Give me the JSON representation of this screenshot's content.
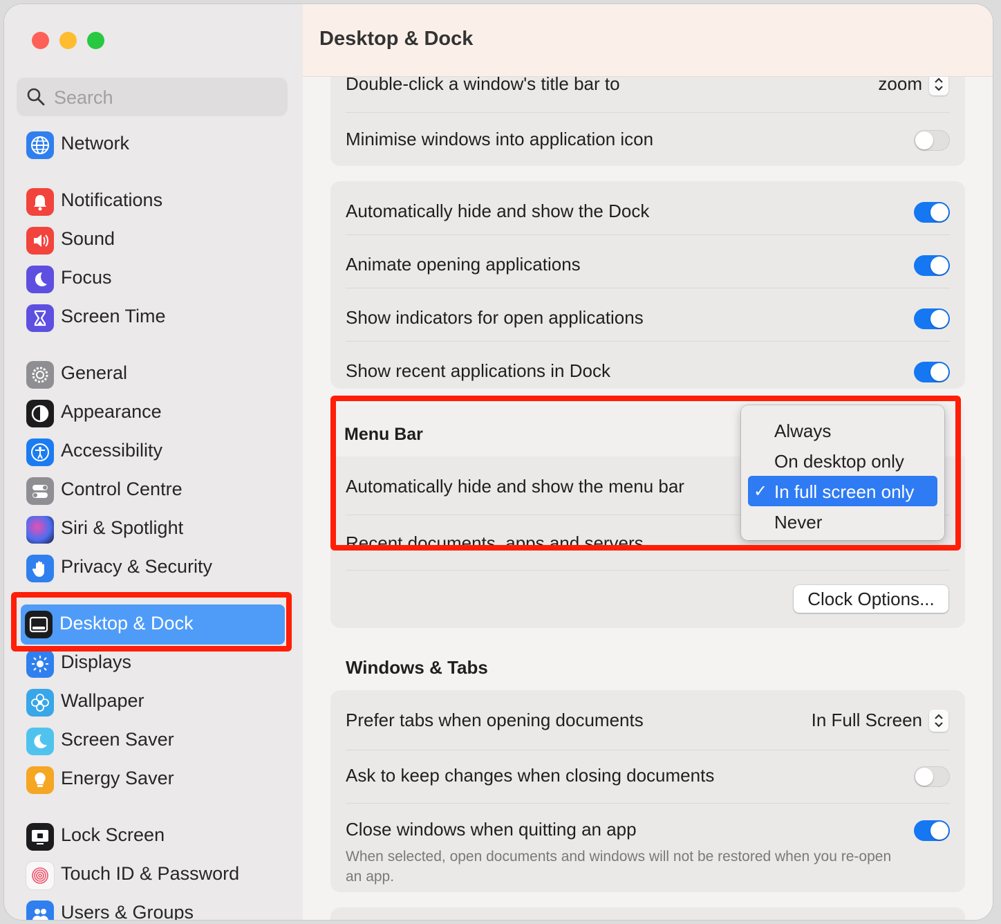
{
  "window": {
    "title": "Desktop & Dock",
    "traffic_lights": [
      "#fe5f57",
      "#febc2e",
      "#28c840"
    ]
  },
  "search": {
    "placeholder": "Search"
  },
  "sidebar": {
    "items": [
      {
        "label": "Network",
        "icon": "globe-icon",
        "color": "#2f80ee"
      },
      {
        "label": "Notifications",
        "icon": "bell-icon",
        "color": "#f2433d"
      },
      {
        "label": "Sound",
        "icon": "speaker-icon",
        "color": "#f2433d"
      },
      {
        "label": "Focus",
        "icon": "moon-icon",
        "color": "#5d4fe0"
      },
      {
        "label": "Screen Time",
        "icon": "hourglass-icon",
        "color": "#5d4fe0"
      },
      {
        "label": "General",
        "icon": "gear-icon",
        "color": "#8e8e93"
      },
      {
        "label": "Appearance",
        "icon": "appearance-icon",
        "color": "#1c1c1e"
      },
      {
        "label": "Accessibility",
        "icon": "accessibility-icon",
        "color": "#1b7cf2"
      },
      {
        "label": "Control Centre",
        "icon": "switches-icon",
        "color": "#8e8e93"
      },
      {
        "label": "Siri & Spotlight",
        "icon": "siri-icon",
        "color": "#3a3a8e"
      },
      {
        "label": "Privacy & Security",
        "icon": "hand-icon",
        "color": "#2f80ee"
      },
      {
        "label": "Desktop & Dock",
        "icon": "dock-icon",
        "color": "#1c1c1e"
      },
      {
        "label": "Displays",
        "icon": "sun-icon",
        "color": "#2f80ee"
      },
      {
        "label": "Wallpaper",
        "icon": "flower-icon",
        "color": "#38a6e8"
      },
      {
        "label": "Screen Saver",
        "icon": "screensaver-icon",
        "color": "#4fc3ee"
      },
      {
        "label": "Energy Saver",
        "icon": "bulb-icon",
        "color": "#f5a623"
      },
      {
        "label": "Lock Screen",
        "icon": "lock-screen-icon",
        "color": "#1c1c1e"
      },
      {
        "label": "Touch ID & Password",
        "icon": "fingerprint-icon",
        "color": "#f8f8f8"
      },
      {
        "label": "Users & Groups",
        "icon": "users-icon",
        "color": "#2f80ee"
      }
    ],
    "selected": "Desktop & Dock"
  },
  "main": {
    "title": "Desktop & Dock",
    "rows_top": [
      {
        "label": "Double-click a window's title bar to",
        "value": "zoom"
      },
      {
        "label": "Minimise windows into application icon",
        "toggle": false
      }
    ],
    "rows_dock": [
      {
        "label": "Automatically hide and show the Dock",
        "toggle": true
      },
      {
        "label": "Animate opening applications",
        "toggle": true
      },
      {
        "label": "Show indicators for open applications",
        "toggle": true
      },
      {
        "label": "Show recent applications in Dock",
        "toggle": true
      }
    ],
    "menu_bar": {
      "heading": "Menu Bar",
      "row_label": "Automatically hide and show the menu bar",
      "cut_label": "Recent documents, apps and servers",
      "options": [
        "Always",
        "On desktop only",
        "In full screen only",
        "Never"
      ],
      "selected": "In full screen only",
      "check": "✓",
      "clock_button": "Clock Options..."
    },
    "windows_tabs": {
      "heading": "Windows & Tabs",
      "prefer_tabs": {
        "label": "Prefer tabs when opening documents",
        "value": "In Full Screen"
      },
      "ask_keep": {
        "label": "Ask to keep changes when closing documents",
        "toggle": false
      },
      "close_windows": {
        "label": "Close windows when quitting an app",
        "toggle": true,
        "description": "When selected, open documents and windows will not be restored when you re-open an app."
      }
    }
  },
  "colors": {
    "accent": "#1577f2",
    "selection": "#4f9cf8",
    "highlight": "#ff1e07"
  }
}
